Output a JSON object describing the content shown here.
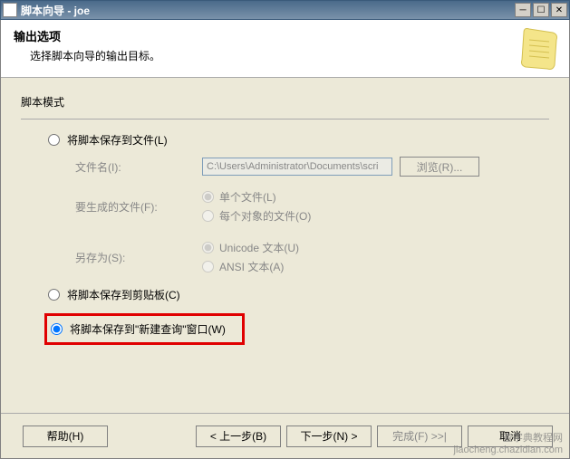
{
  "window": {
    "title": "脚本向导 - joe"
  },
  "header": {
    "title": "输出选项",
    "subtitle": "选择脚本向导的输出目标。"
  },
  "fieldset_label": "脚本模式",
  "opt_save_file": "将脚本保存到文件(L)",
  "file_name_label": "文件名(I):",
  "file_name_value": "C:\\Users\\Administrator\\Documents\\scri",
  "browse_label": "浏览(R)...",
  "generate_label": "要生成的文件(F):",
  "gen_single": "单个文件(L)",
  "gen_perobj": "每个对象的文件(O)",
  "saveas_label": "另存为(S):",
  "saveas_unicode": "Unicode 文本(U)",
  "saveas_ansi": "ANSI 文本(A)",
  "opt_save_clip": "将脚本保存到剪贴板(C)",
  "opt_save_query": "将脚本保存到\"新建查询\"窗口(W)",
  "buttons": {
    "help": "帮助(H)",
    "back": "< 上一步(B)",
    "next": "下一步(N) >",
    "finish": "完成(F) >>|",
    "cancel": "取消"
  },
  "watermark": "查字典教程网\njiaocheng.chazidian.com"
}
